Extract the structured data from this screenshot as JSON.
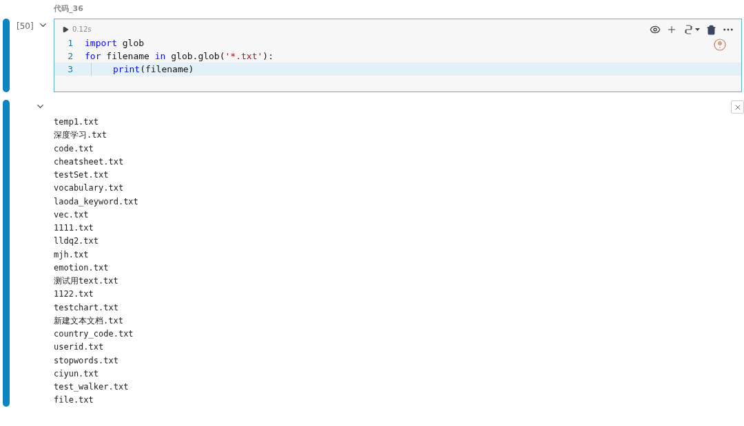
{
  "cell_label": "代码_36",
  "code_cell": {
    "execution_count": "[50]",
    "expanded": true,
    "run_time": "0.12s",
    "lines": [
      {
        "number": "1",
        "current": false,
        "indent": false,
        "tokens": [
          {
            "kind": "keyword",
            "text": "import"
          },
          {
            "kind": "plain",
            "text": " glob"
          }
        ]
      },
      {
        "number": "2",
        "current": false,
        "indent": false,
        "tokens": [
          {
            "kind": "keyword",
            "text": "for"
          },
          {
            "kind": "plain",
            "text": " filename "
          },
          {
            "kind": "keyword",
            "text": "in"
          },
          {
            "kind": "plain",
            "text": " glob.glob("
          },
          {
            "kind": "string",
            "text": "'*.txt'"
          },
          {
            "kind": "plain",
            "text": "):"
          }
        ]
      },
      {
        "number": "3",
        "current": true,
        "indent": true,
        "tokens": [
          {
            "kind": "builtin",
            "text": "print"
          },
          {
            "kind": "plain",
            "text": "(filename)"
          }
        ]
      }
    ]
  },
  "output": {
    "expanded": true,
    "lines": [
      "temp1.txt",
      "深度学习.txt",
      "code.txt",
      "cheatsheet.txt",
      "testSet.txt",
      "vocabulary.txt",
      "laoda_keyword.txt",
      "vec.txt",
      "1111.txt",
      "lldq2.txt",
      "mjh.txt",
      "emotion.txt",
      "测试用text.txt",
      "1122.txt",
      "testchart.txt",
      "新建文本文档.txt",
      "country_code.txt",
      "userid.txt",
      "stopwords.txt",
      "ciyun.txt",
      "test_walker.txt",
      "file.txt"
    ]
  }
}
